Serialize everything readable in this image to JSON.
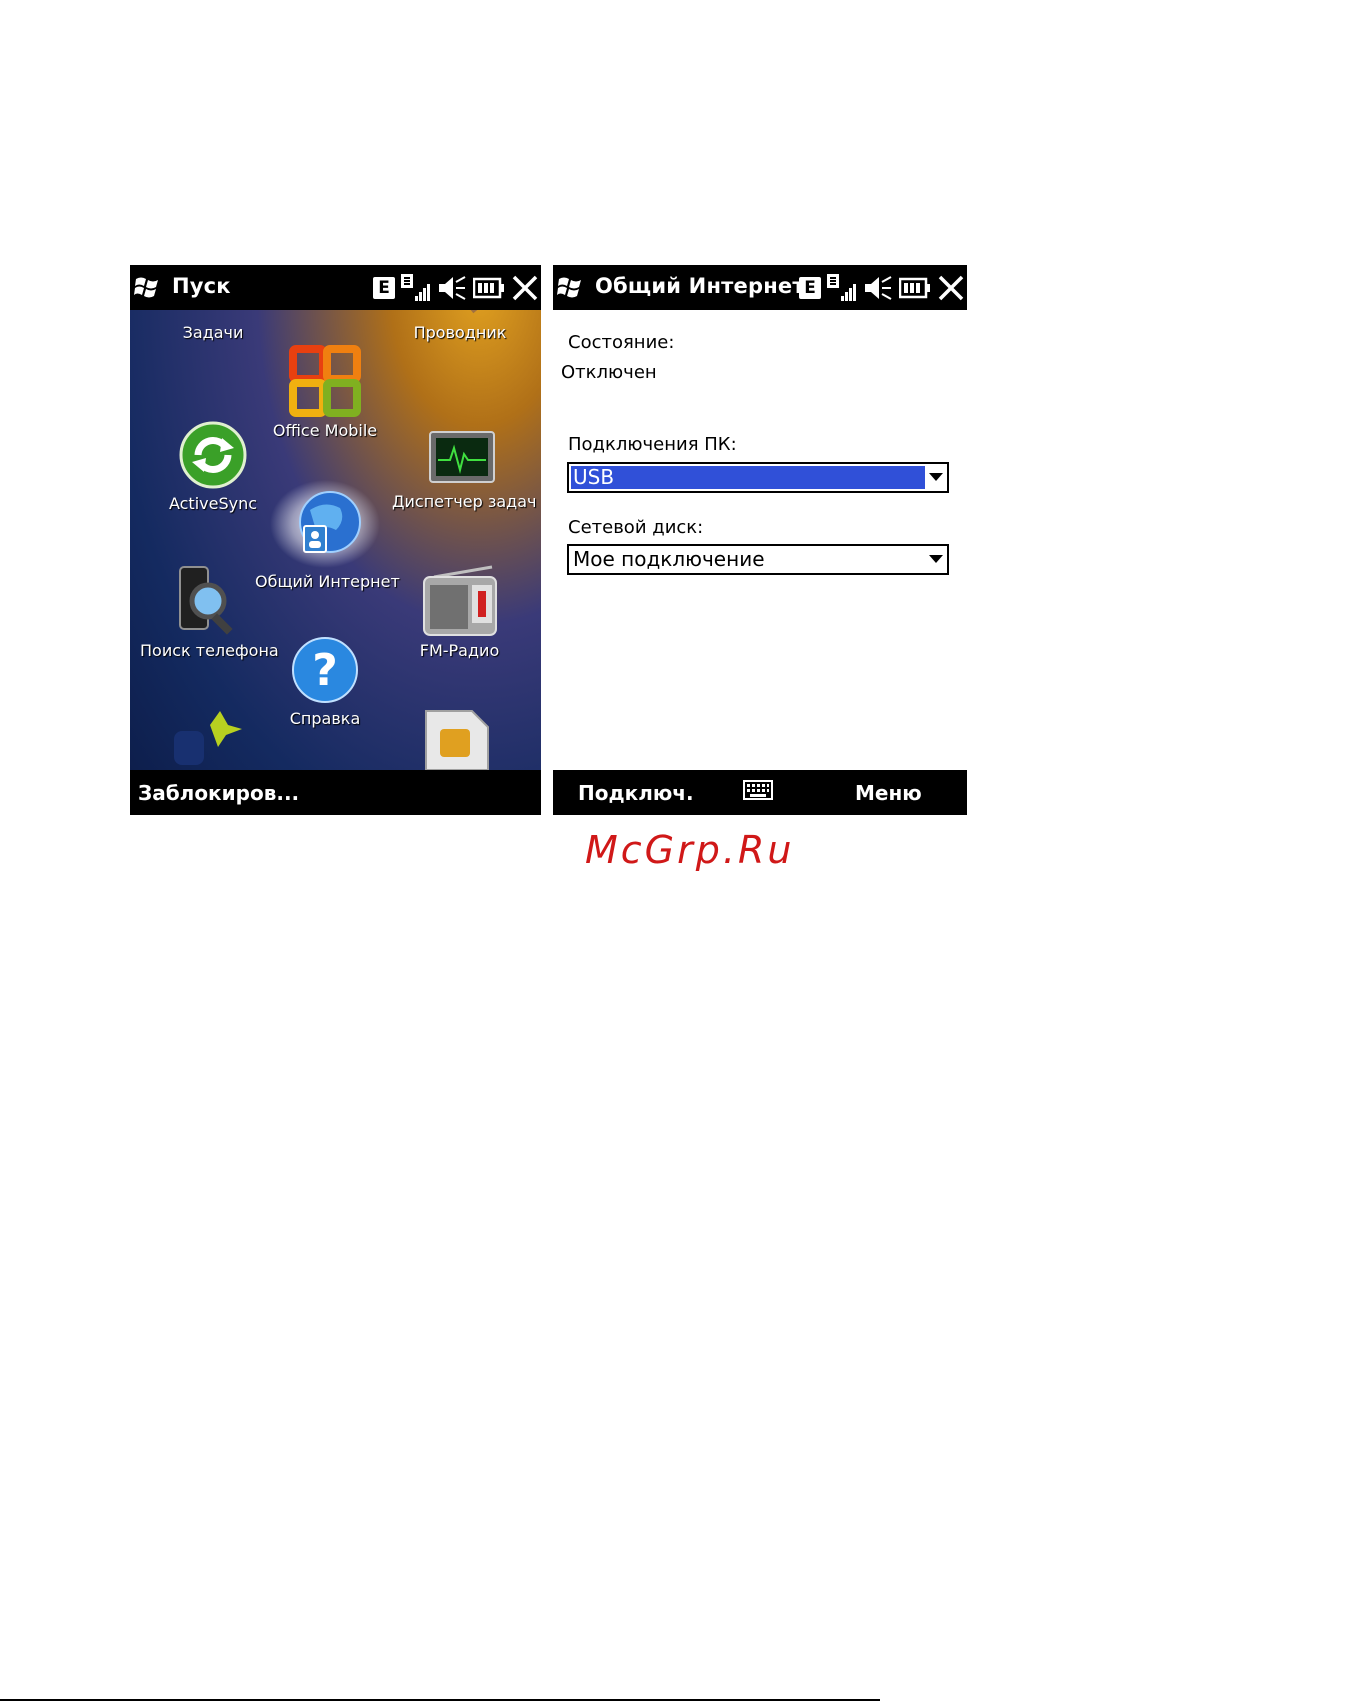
{
  "left_screen": {
    "title": "Пуск",
    "edge_label": "E",
    "apps": [
      {
        "label": "Задачи",
        "icon": "tasks-icon"
      },
      {
        "label": "Проводник",
        "icon": "explorer-icon"
      },
      {
        "label": "Office Mobile",
        "icon": "office-icon"
      },
      {
        "label": "ActiveSync",
        "icon": "activesync-icon"
      },
      {
        "label": "Диспетчер задач",
        "icon": "task-manager-icon"
      },
      {
        "label": "Общий Интернет",
        "icon": "internet-sharing-icon"
      },
      {
        "label": "Поиск телефона",
        "icon": "phone-search-icon"
      },
      {
        "label": "FM-Радио",
        "icon": "radio-icon"
      },
      {
        "label": "Справка",
        "icon": "help-icon"
      }
    ],
    "softkey_left": "Заблокиров..."
  },
  "right_screen": {
    "title": "Общий Интернет",
    "edge_label": "E",
    "status_label": "Состояние:",
    "status_value": "Отключен",
    "pc_label": "Подключения ПК:",
    "pc_value": "USB",
    "network_label": "Сетевой диск:",
    "network_value": "Мое подключение",
    "softkey_left": "Подключ.",
    "softkey_right": "Меню"
  },
  "watermark": "McGrp.Ru",
  "colors": {
    "selection": "#3050d8",
    "watermark": "#d01818"
  }
}
